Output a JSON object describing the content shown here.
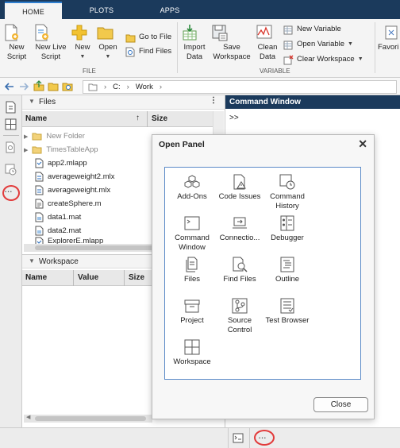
{
  "tabs": [
    {
      "label": "HOME",
      "active": true
    },
    {
      "label": "PLOTS",
      "active": false
    },
    {
      "label": "APPS",
      "active": false
    }
  ],
  "ribbon": {
    "new_script": "New Script",
    "new_live_script": "New Live Script",
    "new": "New",
    "open": "Open",
    "go_to_file": "Go to File",
    "find_files": "Find Files",
    "file_group": "FILE",
    "import_data": "Import Data",
    "save_workspace": "Save Workspace",
    "clean_data": "Clean Data",
    "new_variable": "New Variable",
    "open_variable": "Open Variable",
    "clear_workspace": "Clear Workspace",
    "variable_group": "VARIABLE",
    "favorites": "Favori"
  },
  "address": {
    "drive": "C:",
    "folder": "Work"
  },
  "files_panel": {
    "title": "Files",
    "col_name": "Name",
    "col_size": "Size",
    "rows": [
      {
        "name": "New Folder",
        "type": "folder"
      },
      {
        "name": "TimesTableApp",
        "type": "folder"
      },
      {
        "name": "app2.mlapp",
        "type": "app"
      },
      {
        "name": "averageweight2.mlx",
        "type": "mlx"
      },
      {
        "name": "averageweight.mlx",
        "type": "mlx"
      },
      {
        "name": "createSphere.m",
        "type": "m"
      },
      {
        "name": "data1.mat",
        "type": "mat"
      },
      {
        "name": "data2.mat",
        "type": "mat"
      },
      {
        "name": "ExplorerE.mlapp",
        "type": "app"
      }
    ]
  },
  "workspace_panel": {
    "title": "Workspace",
    "col_name": "Name",
    "col_value": "Value",
    "col_size": "Size"
  },
  "command_window": {
    "title": "Command Window",
    "prompt": ">>"
  },
  "open_panel": {
    "title": "Open Panel",
    "close_label": "Close",
    "items": [
      {
        "label": "Add-Ons",
        "icon": "add-ons-icon"
      },
      {
        "label": "Code Issues",
        "icon": "code-issues-icon"
      },
      {
        "label": "Command History",
        "icon": "command-history-icon"
      },
      {
        "label": "Command Window",
        "icon": "command-window-icon"
      },
      {
        "label": "Connectio...",
        "icon": "connections-icon"
      },
      {
        "label": "Debugger",
        "icon": "debugger-icon"
      },
      {
        "label": "Files",
        "icon": "files-icon"
      },
      {
        "label": "Find Files",
        "icon": "find-files-icon"
      },
      {
        "label": "Outline",
        "icon": "outline-icon"
      },
      {
        "label": "Project",
        "icon": "project-icon"
      },
      {
        "label": "Source Control",
        "icon": "source-control-icon"
      },
      {
        "label": "Test Browser",
        "icon": "test-browser-icon"
      },
      {
        "label": "Workspace",
        "icon": "workspace-icon"
      }
    ]
  },
  "more_glyph": "···",
  "colors": {
    "titlebar": "#1b3a5c",
    "highlight": "#e23b3b",
    "accent": "#2f7fd0"
  }
}
